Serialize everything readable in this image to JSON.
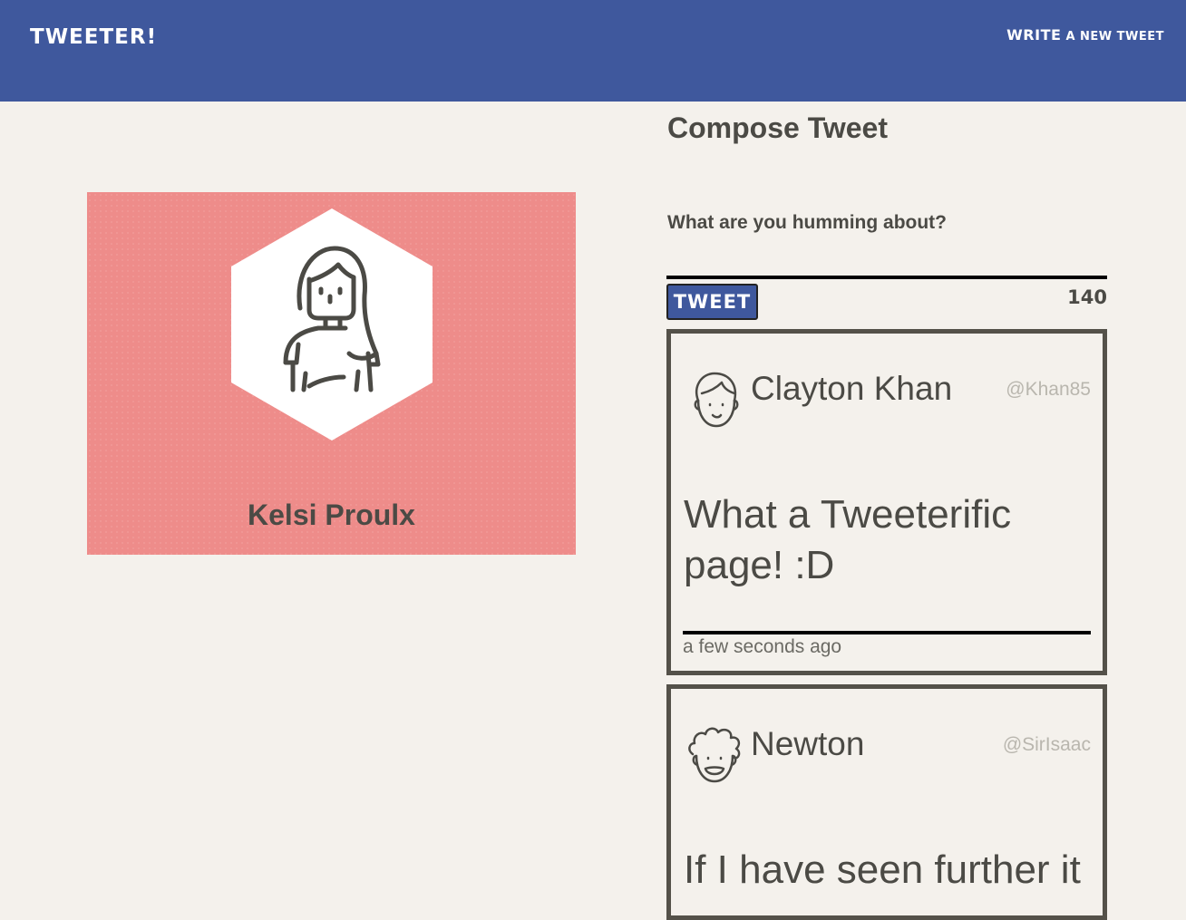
{
  "navbar": {
    "brand": "TWEETER!",
    "write_link": {
      "word1": "WRITE",
      "word2": " A NEW TWEET"
    },
    "color": "#3f589d"
  },
  "profile": {
    "name": "Kelsi Proulx",
    "card_color": "#ee8c8a",
    "avatar_icon": "woman-avatar-icon"
  },
  "compose": {
    "title": "Compose Tweet",
    "label": "What are you humming about?",
    "input_value": "",
    "button_label": "TWEET",
    "counter": "140"
  },
  "tweets": [
    {
      "name": "Clayton Khan",
      "handle": "@Khan85",
      "body": "What a Tweeterific page! :D",
      "time": "a few seconds ago",
      "avatar_icon": "man-avatar-icon"
    },
    {
      "name": "Newton",
      "handle": "@SirIsaac",
      "body": "If I have seen further it",
      "avatar_icon": "curly-hair-avatar-icon"
    }
  ]
}
